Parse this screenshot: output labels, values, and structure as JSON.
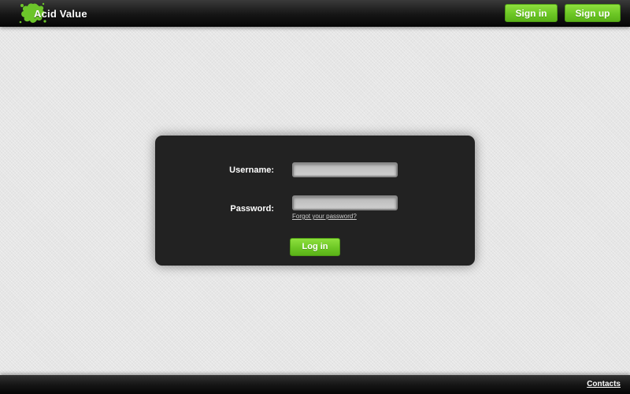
{
  "header": {
    "logo_text": "Acid Value",
    "logo_icon": "green-splash-icon",
    "signin_label": "Sign in",
    "signup_label": "Sign up"
  },
  "login": {
    "username_label": "Username:",
    "username_value": "",
    "password_label": "Password:",
    "password_value": "",
    "forgot_label": "Forgot your password?",
    "submit_label": "Log in"
  },
  "footer": {
    "contacts_label": "Contacts"
  },
  "colors": {
    "accent": "#6dc725",
    "header_bg": "#151515",
    "panel_bg": "#222222",
    "page_bg": "#e6e6e6"
  }
}
